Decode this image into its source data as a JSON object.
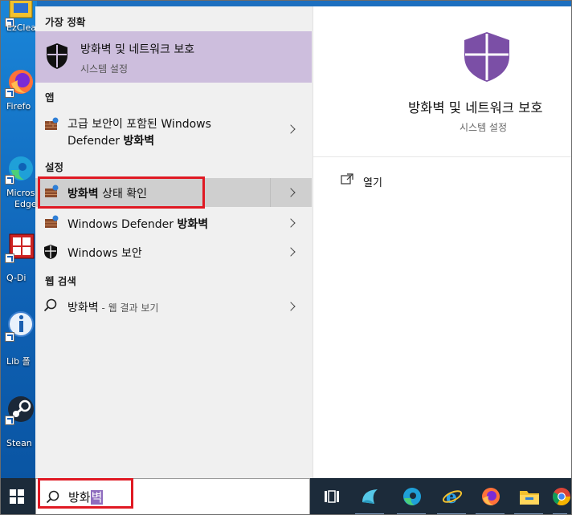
{
  "desktop": {
    "icons": [
      {
        "label": "EzClea",
        "icon": "ezclean-icon"
      },
      {
        "label": "Firefo",
        "icon": "firefox-icon"
      },
      {
        "label": "Micros",
        "label2": "Edge",
        "icon": "edge-icon"
      },
      {
        "label": "Q-Di",
        "icon": "qdir-icon"
      },
      {
        "label": "Lib 폴",
        "icon": "info-icon"
      },
      {
        "label": "Stean",
        "icon": "steam-icon"
      }
    ]
  },
  "results": {
    "best_match": {
      "header": "가장 정확",
      "title": "방화벽 및 네트워크 보호",
      "subtitle": "시스템 설정",
      "icon": "shield-icon"
    },
    "apps": {
      "header": "앱",
      "items": [
        {
          "line1": "고급 보안이 포함된 Windows",
          "line2_pre": "Defender ",
          "line2_bold": "방화벽",
          "icon": "firewall-icon"
        }
      ]
    },
    "settings": {
      "header": "설정",
      "items": [
        {
          "pre": "",
          "bold": "방화벽",
          "post": " 상태 확인",
          "icon": "firewall-icon"
        },
        {
          "pre": "Windows Defender ",
          "bold": "방화벽",
          "post": "",
          "icon": "firewall-icon"
        },
        {
          "pre": "Windows 보안",
          "bold": "",
          "post": "",
          "icon": "shield-icon"
        }
      ]
    },
    "web": {
      "header": "웹 검색",
      "items": [
        {
          "query": "방화벽",
          "suffix": " - 웹 결과 보기",
          "icon": "search-icon"
        }
      ]
    }
  },
  "preview": {
    "title": "방화벽 및 네트워크 보호",
    "subtitle": "시스템 설정",
    "open_label": "열기",
    "accent": "#7b4fa6"
  },
  "taskbar": {
    "search_text": "방화",
    "search_selected": "벽",
    "icons": [
      "task-view-icon",
      "app-icon",
      "edge-icon",
      "ie-icon",
      "firefox-icon",
      "file-explorer-icon",
      "chrome-icon"
    ]
  },
  "colors": {
    "highlight_red": "#e01923",
    "best_match_bg": "#cdbedd",
    "taskbar_bg": "#1c2b3a"
  }
}
